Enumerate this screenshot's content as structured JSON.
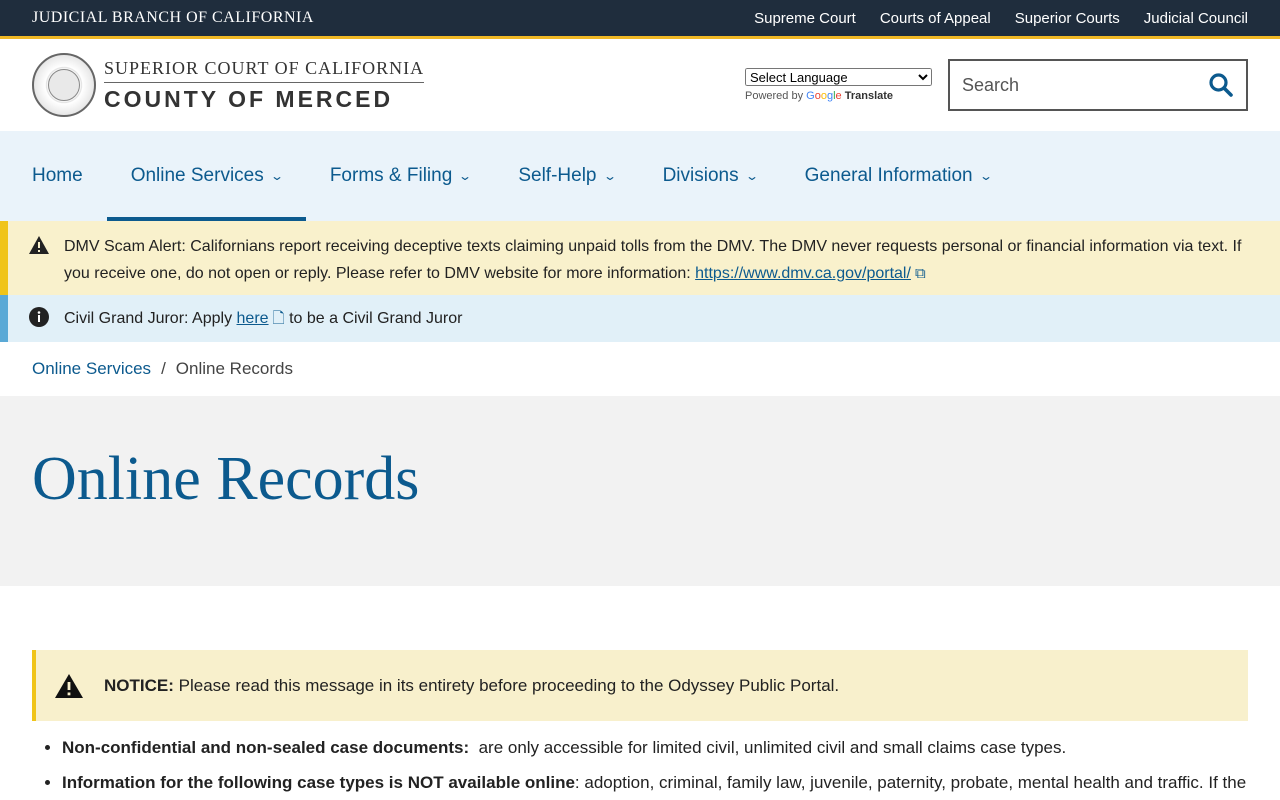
{
  "topbar": {
    "brand": "JUDICIAL BRANCH OF CALIFORNIA",
    "links": [
      "Supreme Court",
      "Courts of Appeal",
      "Superior Courts",
      "Judicial Council"
    ]
  },
  "header": {
    "logo_line1": "SUPERIOR COURT OF CALIFORNIA",
    "logo_line2": "COUNTY OF MERCED",
    "language_select": "Select Language",
    "powered_by": "Powered by",
    "google": "Google",
    "translate": "Translate",
    "search_placeholder": "Search"
  },
  "nav": {
    "items": [
      {
        "label": "Home"
      },
      {
        "label": "Online Services"
      },
      {
        "label": "Forms & Filing"
      },
      {
        "label": "Self-Help"
      },
      {
        "label": "Divisions"
      },
      {
        "label": "General Information"
      }
    ]
  },
  "alerts": {
    "dmv_text": "DMV Scam Alert: Californians report receiving deceptive texts claiming unpaid tolls from the DMV. The DMV never requests personal or financial information via text. If you receive one, do not open or reply. Please refer to DMV website for more information:",
    "dmv_link": "https://www.dmv.ca.gov/portal/",
    "juror_prefix": "Civil Grand Juror: Apply",
    "juror_link": "here",
    "juror_suffix": "to be a Civil Grand Juror"
  },
  "breadcrumb": {
    "parent": "Online Services",
    "separator": "/",
    "current": "Online Records"
  },
  "page": {
    "title": "Online Records",
    "notice_label": "NOTICE:",
    "notice_text": "Please read this message in its entirety before proceeding to the Odyssey Public Portal.",
    "bullets": [
      {
        "bold": "Non-confidential and non-sealed case documents:",
        "text": "are only accessible for limited civil, unlimited civil and small claims case types."
      },
      {
        "bold": "Information for the following case types is NOT available online",
        "text": ": adoption, criminal, family law, juvenile, paternity, probate, mental health and traffic. If the"
      }
    ]
  },
  "colors": {
    "topbar": "#1f2d3d",
    "accent_gold": "#f0b825",
    "link_blue": "#0c5a8e",
    "nav_bg": "#eaf3fa"
  }
}
